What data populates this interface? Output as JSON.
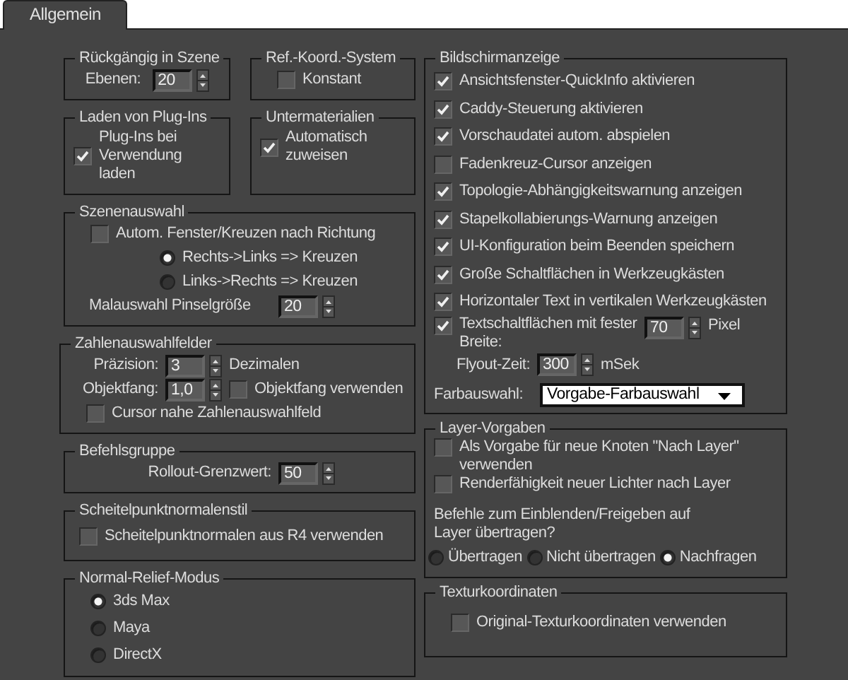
{
  "tabs": [
    {
      "label": "Allgemein",
      "selected": true
    }
  ],
  "undo": {
    "title": "Rückgängig in Szene",
    "label": "Ebenen:",
    "value": "20"
  },
  "ref_coord": {
    "title": "Ref.-Koord.-System",
    "checkbox": {
      "label": "Konstant",
      "checked": false
    }
  },
  "plugins": {
    "title": "Laden von Plug-Ins",
    "checkbox": {
      "label": "Plug-Ins bei Verwendung laden",
      "checked": true
    }
  },
  "submaterials": {
    "title": "Untermaterialien",
    "checkbox": {
      "label": "Automatisch zuweisen",
      "checked": true
    }
  },
  "scene_selection": {
    "title": "Szenenauswahl",
    "checkbox": {
      "label": "Autom. Fenster/Kreuzen nach Richtung",
      "checked": false
    },
    "radios": [
      {
        "label": "Rechts->Links => Kreuzen",
        "selected": true
      },
      {
        "label": "Links->Rechts => Kreuzen",
        "selected": false
      }
    ],
    "brush": {
      "label": "Malauswahl Pinselgröße",
      "value": "20"
    }
  },
  "spinners": {
    "title": "Zahlenauswahlfelder",
    "precision": {
      "label": "Präzision:",
      "value": "3",
      "unit": "Dezimalen"
    },
    "snap": {
      "label": "Objektfang:",
      "value": "1,0",
      "checkbox": {
        "label": "Objektfang verwenden",
        "checked": false
      }
    },
    "cursor": {
      "label": "Cursor nahe Zahlenauswahlfeld",
      "checked": false
    }
  },
  "command_panel": {
    "title": "Befehlsgruppe",
    "label": "Rollout-Grenzwert:",
    "value": "50"
  },
  "vertex_normals": {
    "title": "Scheitelpunktnormalenstil",
    "checkbox": {
      "label": "Scheitelpunktnormalen aus R4 verwenden",
      "checked": false
    }
  },
  "normal_bump": {
    "title": "Normal-Relief-Modus",
    "radios": [
      {
        "label": "3ds Max",
        "selected": true
      },
      {
        "label": "Maya",
        "selected": false
      },
      {
        "label": "DirectX",
        "selected": false
      }
    ]
  },
  "display": {
    "title": "Bildschirmanzeige",
    "checkboxes": [
      {
        "label": "Ansichtsfenster-QuickInfo aktivieren",
        "checked": true
      },
      {
        "label": "Caddy-Steuerung aktivieren",
        "checked": true
      },
      {
        "label": "Vorschaudatei autom. abspielen",
        "checked": true
      },
      {
        "label": "Fadenkreuz-Cursor anzeigen",
        "checked": false
      },
      {
        "label": "Topologie-Abhängigkeitswarnung anzeigen",
        "checked": true
      },
      {
        "label": "Stapelkollabierungs-Warnung anzeigen",
        "checked": true
      },
      {
        "label": "UI-Konfiguration beim Beenden speichern",
        "checked": true
      },
      {
        "label": "Große Schaltflächen in Werkzeugkästen",
        "checked": true
      },
      {
        "label": "Horizontaler Text in vertikalen Werkzeugkästen",
        "checked": true
      }
    ],
    "fixed_width": {
      "label": "Textschaltflächen mit fester Breite:",
      "checked": true,
      "value": "70",
      "unit": "Pixel"
    },
    "flyout": {
      "label": "Flyout-Zeit:",
      "value": "300",
      "unit": "mSek"
    },
    "color_picker": {
      "label": "Farbauswahl:",
      "value": "Vorgabe-Farbauswahl"
    }
  },
  "layer_defaults": {
    "title": "Layer-Vorgaben",
    "checkboxes": [
      {
        "label": "Als Vorgabe für neue Knoten \"Nach Layer\" verwenden",
        "checked": false
      },
      {
        "label": "Renderfähigkeit neuer Lichter nach Layer",
        "checked": false
      }
    ],
    "question": "Befehle zum Einblenden/Freigeben auf Layer übertragen?",
    "radios": [
      {
        "label": "Übertragen",
        "selected": false
      },
      {
        "label": "Nicht übertragen",
        "selected": false
      },
      {
        "label": "Nachfragen",
        "selected": true
      }
    ]
  },
  "texture_coords": {
    "title": "Texturkoordinaten",
    "checkbox": {
      "label": "Original-Texturkoordinaten verwenden",
      "checked": false
    }
  }
}
